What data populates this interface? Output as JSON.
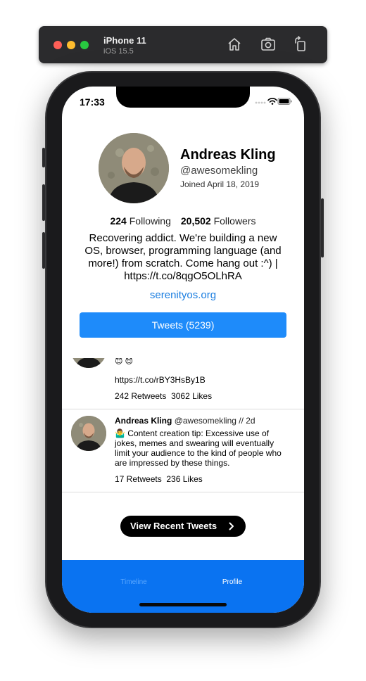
{
  "simulator": {
    "device_name": "iPhone 11",
    "os_version": "iOS 15.5"
  },
  "status_bar": {
    "time": "17:33"
  },
  "profile": {
    "name": "Andreas Kling",
    "handle": "@awesomekling",
    "joined": "Joined April 18, 2019",
    "following_count": "224",
    "following_label": "Following",
    "followers_count": "20,502",
    "followers_label": "Followers",
    "bio": "Recovering addict. We're building a new OS, browser, programming language (and more!) from scratch. Come hang out :^) | https://t.co/8qgO5OLhRA",
    "link": "serenityos.org",
    "tweets_button": "Tweets (5239)"
  },
  "tweets": [
    {
      "emoji": "😇 😈",
      "link": "https://t.co/rBY3HsBy1B",
      "retweets": "242 Retweets",
      "likes": "3062 Likes"
    },
    {
      "author": "Andreas Kling",
      "handle_time": "@awesomekling // 2d",
      "text": "🤷‍♂️ Content creation tip: Excessive use of jokes, memes and swearing will eventually limit your audience to the kind of people who are impressed by these things.",
      "retweets": "17 Retweets",
      "likes": "236 Likes"
    }
  ],
  "view_recent_button": "View Recent Tweets",
  "tab_bar": {
    "timeline": "Timeline",
    "profile": "Profile"
  },
  "colors": {
    "accent": "#1e8bfa",
    "tab_bar": "#0a73f1",
    "link": "#1a7de0"
  },
  "icons": [
    "home-icon",
    "screenshot-icon",
    "rotate-icon",
    "wifi-icon",
    "battery-icon",
    "chevron-right-icon"
  ]
}
